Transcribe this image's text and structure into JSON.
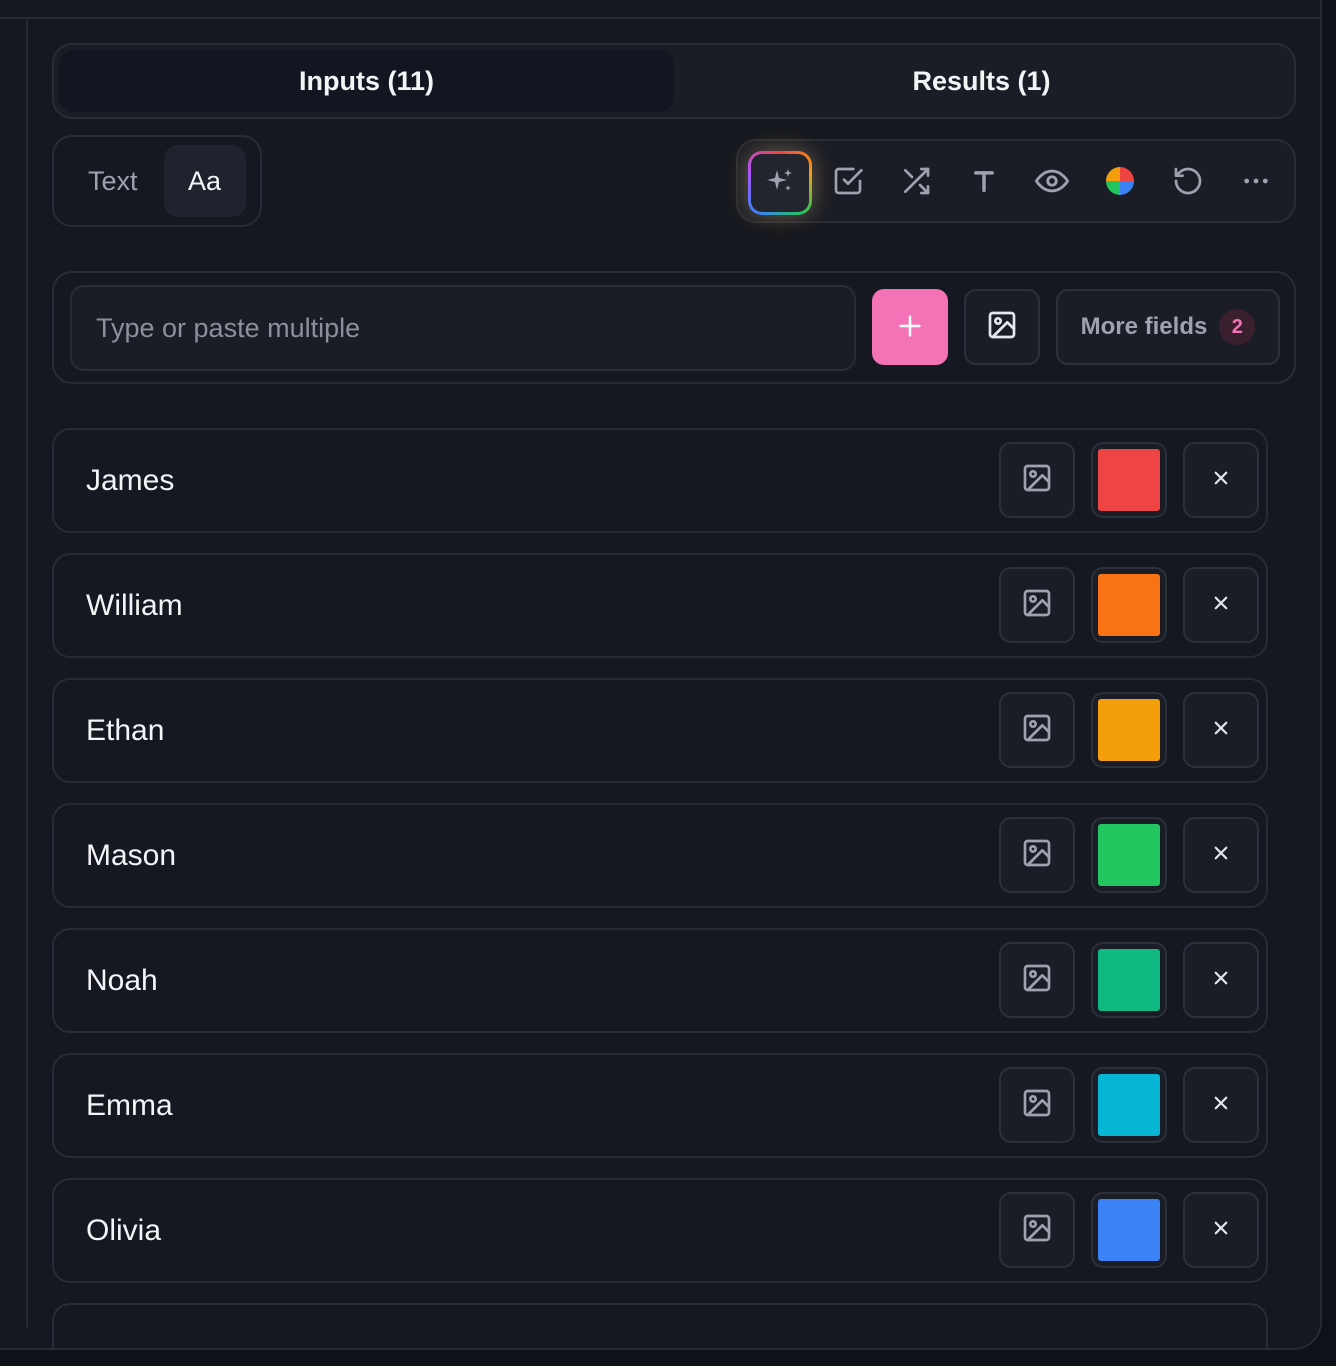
{
  "tabs": [
    {
      "label": "Inputs (11)",
      "active": true
    },
    {
      "label": "Results (1)",
      "active": false
    }
  ],
  "mode": {
    "text_label": "Text",
    "font_label": "Aa"
  },
  "toolbar": {
    "icons": [
      "sparkles-icon",
      "checkbox-icon",
      "shuffle-icon",
      "text-icon",
      "eye-icon",
      "color-wheel-icon",
      "reset-icon",
      "more-icon"
    ]
  },
  "entry": {
    "placeholder": "Type or paste multiple",
    "add_icon": "plus-icon",
    "image_icon": "image-icon",
    "more_fields_label": "More fields",
    "more_fields_count": "2"
  },
  "colors": {
    "accent": "#f472b6",
    "background": "#151820",
    "border": "#282c36"
  },
  "items": [
    {
      "name": "James",
      "color": "#ef4444"
    },
    {
      "name": "William",
      "color": "#f97316"
    },
    {
      "name": "Ethan",
      "color": "#f59e0b"
    },
    {
      "name": "Mason",
      "color": "#22c55e"
    },
    {
      "name": "Noah",
      "color": "#10b981"
    },
    {
      "name": "Emma",
      "color": "#06b6d4"
    },
    {
      "name": "Olivia",
      "color": "#3b82f6"
    }
  ]
}
